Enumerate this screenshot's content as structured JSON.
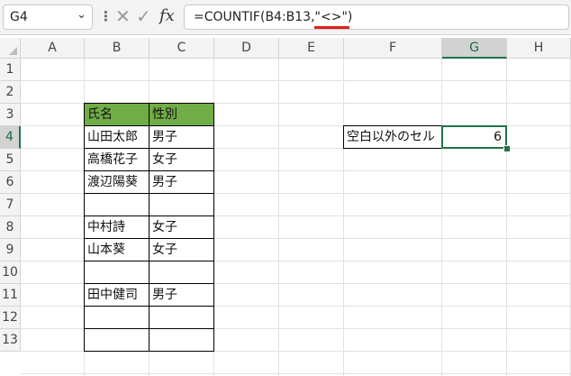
{
  "name_box": "G4",
  "formula": "=COUNTIF(B4:B13,\"<>\")",
  "column_headers": [
    "A",
    "B",
    "C",
    "D",
    "E",
    "F",
    "G",
    "H"
  ],
  "row_headers": [
    "1",
    "2",
    "3",
    "4",
    "5",
    "6",
    "7",
    "8",
    "9",
    "10",
    "11",
    "12",
    "13"
  ],
  "table": {
    "header": {
      "name": "氏名",
      "gender": "性別"
    },
    "rows": [
      {
        "name": "山田太郎",
        "gender": "男子"
      },
      {
        "name": "高橋花子",
        "gender": "女子"
      },
      {
        "name": "渡辺陽葵",
        "gender": "男子"
      },
      {
        "name": "",
        "gender": ""
      },
      {
        "name": "中村詩",
        "gender": "女子"
      },
      {
        "name": "山本葵",
        "gender": "女子"
      },
      {
        "name": "",
        "gender": ""
      },
      {
        "name": "田中健司",
        "gender": "男子"
      },
      {
        "name": "",
        "gender": ""
      },
      {
        "name": "",
        "gender": ""
      }
    ]
  },
  "result": {
    "label": "空白以外のセル",
    "value": "6"
  },
  "selected_cell": {
    "column": "G",
    "row": "4"
  },
  "colors": {
    "accent": "#217346",
    "table_header": "#70ad47",
    "underline": "#e0201a"
  }
}
